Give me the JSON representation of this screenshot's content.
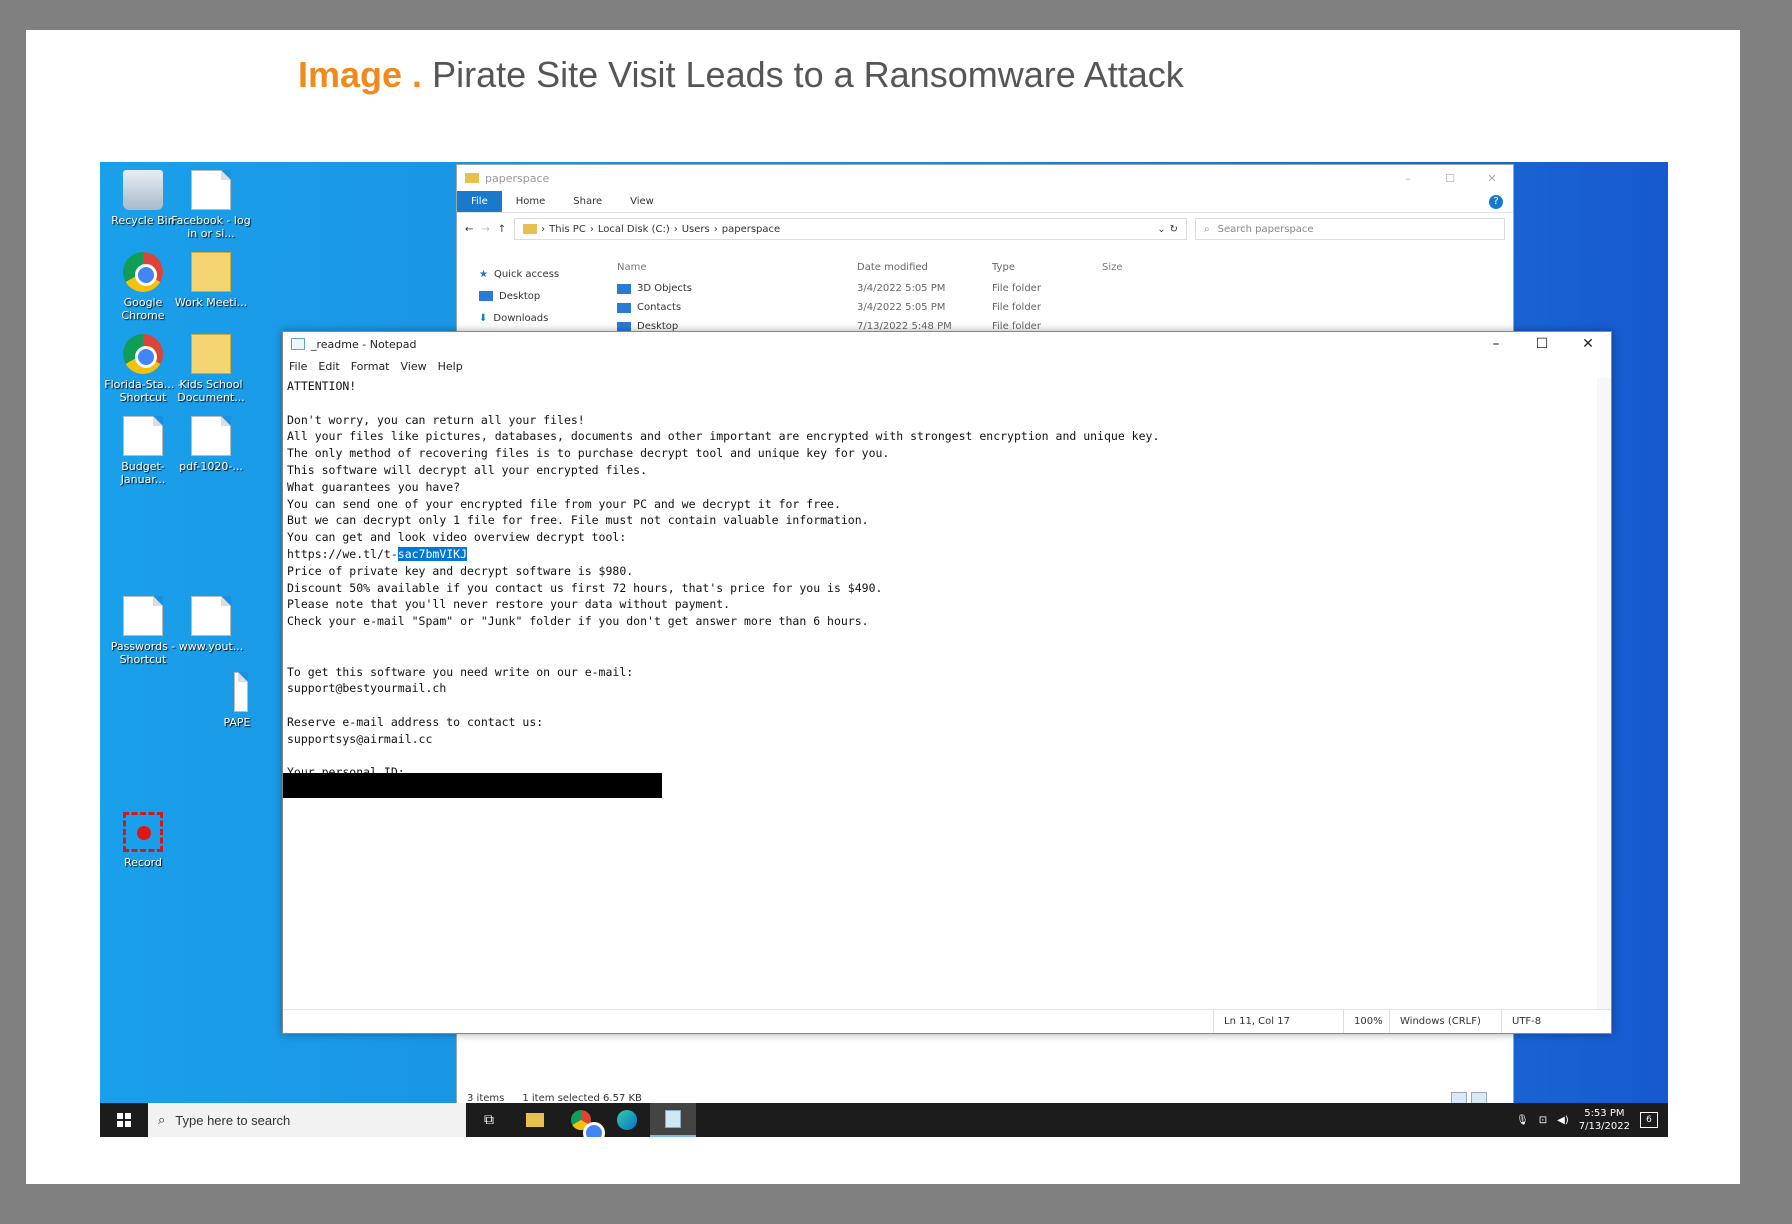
{
  "caption": {
    "prefix": "Image .",
    "title": "Pirate Site Visit Leads to a Ransomware Attack"
  },
  "desktop": {
    "icons": [
      {
        "label": "Recycle Bin"
      },
      {
        "label": "Facebook - log in or si..."
      },
      {
        "label": "Google Chrome"
      },
      {
        "label": "Work Meeti..."
      },
      {
        "label": "Florida-Sta... - Shortcut"
      },
      {
        "label": "Kids School Document..."
      },
      {
        "label": "Budget-Januar..."
      },
      {
        "label": "pdf-1020-..."
      },
      {
        "label": "Passwords - Shortcut"
      },
      {
        "label": "www.yout..."
      },
      {
        "label": "PAPE"
      },
      {
        "label": "Record"
      }
    ]
  },
  "explorer": {
    "title": "paperspace",
    "tabs": [
      "File",
      "Home",
      "Share",
      "View"
    ],
    "breadcrumb": [
      "This PC",
      "Local Disk (C:)",
      "Users",
      "paperspace"
    ],
    "search_placeholder": "Search paperspace",
    "nav": [
      "Quick access",
      "Desktop",
      "Downloads"
    ],
    "columns": [
      "Name",
      "Date modified",
      "Type",
      "Size"
    ],
    "rows": [
      {
        "name": "3D Objects",
        "date": "3/4/2022 5:05 PM",
        "type": "File folder"
      },
      {
        "name": "Contacts",
        "date": "3/4/2022 5:05 PM",
        "type": "File folder"
      },
      {
        "name": "Desktop",
        "date": "7/13/2022 5:48 PM",
        "type": "File folder"
      }
    ],
    "status": {
      "items": "3 items",
      "selected": "1 item selected  6.57 KB"
    }
  },
  "notepad": {
    "title": "_readme - Notepad",
    "menu": [
      "File",
      "Edit",
      "Format",
      "View",
      "Help"
    ],
    "lines": [
      "ATTENTION!",
      "",
      "Don't worry, you can return all your files!",
      "All your files like pictures, databases, documents and other important are encrypted with strongest encryption and unique key.",
      "The only method of recovering files is to purchase decrypt tool and unique key for you.",
      "This software will decrypt all your encrypted files.",
      "What guarantees you have?",
      "You can send one of your encrypted file from your PC and we decrypt it for free.",
      "But we can decrypt only 1 file for free. File must not contain valuable information.",
      "You can get and look video overview decrypt tool:",
      "",
      "Price of private key and decrypt software is $980.",
      "Discount 50% available if you contact us first 72 hours, that's price for you is $490.",
      "Please note that you'll never restore your data without payment.",
      "Check your e-mail \"Spam\" or \"Junk\" folder if you don't get answer more than 6 hours.",
      "",
      "",
      "To get this software you need write on our e-mail:",
      "support@bestyourmail.ch",
      "",
      "Reserve e-mail address to contact us:",
      "supportsys@airmail.cc",
      "",
      "Your personal ID:"
    ],
    "url_prefix": "https://we.tl/t-",
    "url_selected": "sac7bmVIKJ",
    "status": {
      "position": "Ln 11, Col 17",
      "zoom": "100%",
      "eol": "Windows (CRLF)",
      "encoding": "UTF-8"
    }
  },
  "taskbar": {
    "search_placeholder": "Type here to search",
    "time": "5:53 PM",
    "date": "7/13/2022",
    "notification_count": "6"
  }
}
